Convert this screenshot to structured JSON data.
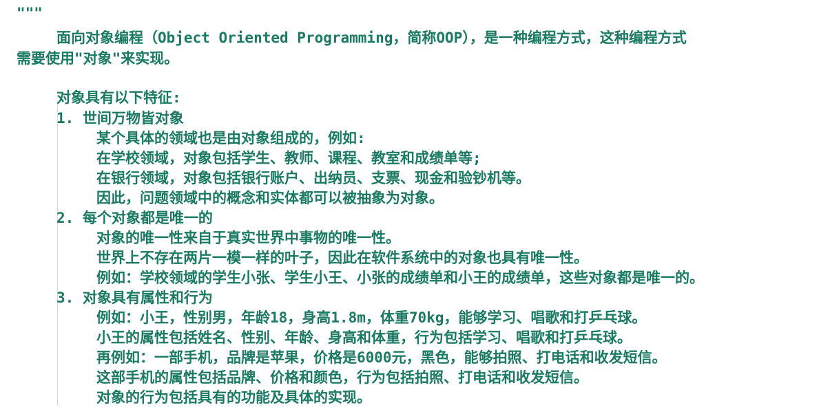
{
  "doc": {
    "quote_mark": "\"\"\"",
    "intro_line1": "面向对象编程（Object Oriented Programming，简称OOP），是一种编程方式，这种编程方式",
    "intro_line2": "需要使用\"对象\"来实现。",
    "features_title": "对象具有以下特征:",
    "p1_title": "1. 世间万物皆对象",
    "p1_l1": "某个具体的领域也是由对象组成的，例如:",
    "p1_l2": "在学校领域，对象包括学生、教师、课程、教室和成绩单等;",
    "p1_l3": "在银行领域，对象包括银行账户、出纳员、支票、现金和验钞机等。",
    "p1_l4": "因此，问题领域中的概念和实体都可以被抽象为对象。",
    "p2_title": "2. 每个对象都是唯一的",
    "p2_l1": "对象的唯一性来自于真实世界中事物的唯一性。",
    "p2_l2": "世界上不存在两片一模一样的叶子，因此在软件系统中的对象也具有唯一性。",
    "p2_l3": "例如：学校领域的学生小张、学生小王、小张的成绩单和小王的成绩单，这些对象都是唯一的。",
    "p3_title": "3. 对象具有属性和行为",
    "p3_l1": "例如：小王，性别男，年龄18，身高1.8m，体重70kg，能够学习、唱歌和打乒乓球。",
    "p3_l2": "小王的属性包括姓名、性别、年龄、身高和体重，行为包括学习、唱歌和打乒乓球。",
    "p3_l3": "再例如：一部手机，品牌是苹果，价格是6000元，黑色，能够拍照、打电话和收发短信。",
    "p3_l4": "这部手机的属性包括品牌、价格和颜色，行为包括拍照、打电话和收发短信。",
    "p3_l5": "对象的行为包括具有的功能及具体的实现。"
  }
}
